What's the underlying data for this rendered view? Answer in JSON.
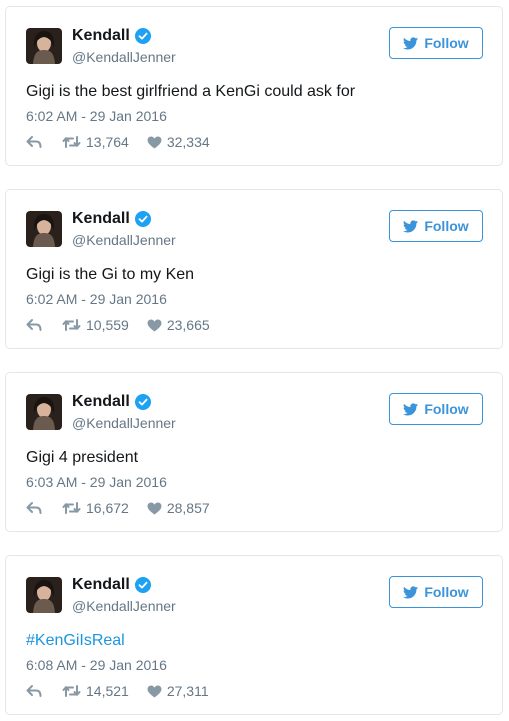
{
  "account": {
    "name": "Kendall",
    "handle": "@KendallJenner",
    "follow_label": "Follow",
    "brand_color": "#1da1f2",
    "verified_icon": "verified-badge-icon"
  },
  "tweets": [
    {
      "text": "Gigi is the best girlfriend a KenGi could ask for",
      "time": "6:02 AM - 29 Jan 2016",
      "retweets": "13,764",
      "likes": "32,334"
    },
    {
      "text": "Gigi is the Gi to my Ken",
      "time": "6:02 AM - 29 Jan 2016",
      "retweets": "10,559",
      "likes": "23,665"
    },
    {
      "text": "Gigi 4 president",
      "time": "6:03 AM - 29 Jan 2016",
      "retweets": "16,672",
      "likes": "28,857"
    },
    {
      "text": "#KenGiIsReal",
      "time": "6:08 AM - 29 Jan 2016",
      "retweets": "14,521",
      "likes": "27,311"
    }
  ]
}
